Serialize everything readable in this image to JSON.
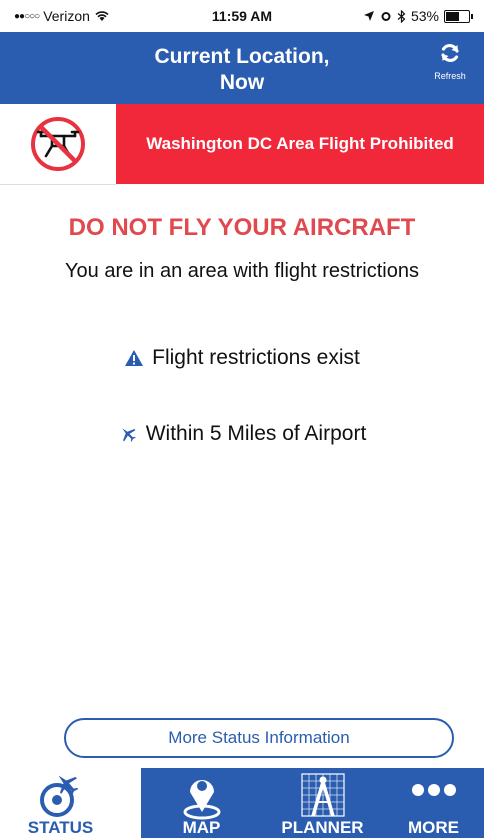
{
  "status_bar": {
    "carrier": "Verizon",
    "time": "11:59 AM",
    "battery": "53%",
    "battery_level": 0.53
  },
  "header": {
    "title_line1": "Current Location,",
    "title_line2": "Now",
    "refresh_label": "Refresh"
  },
  "banner": {
    "text": "Washington DC Area Flight Prohibited",
    "color": "#f0283a",
    "icon": "no-drone-icon"
  },
  "main": {
    "warning": "DO NOT FLY YOUR AIRCRAFT",
    "subtitle": "You are in an area with flight restrictions",
    "items": [
      {
        "icon": "warning-icon",
        "text": "Flight restrictions exist"
      },
      {
        "icon": "airplane-icon",
        "text": "Within 5 Miles of Airport"
      }
    ],
    "more_button": "More Status Information"
  },
  "tabs": [
    {
      "label": "STATUS",
      "icon": "status-icon",
      "active": true
    },
    {
      "label": "MAP",
      "icon": "map-pin-icon",
      "active": false
    },
    {
      "label": "PLANNER",
      "icon": "planner-icon",
      "active": false
    },
    {
      "label": "MORE",
      "icon": "more-icon",
      "active": false
    }
  ],
  "colors": {
    "accent": "#2a5db0",
    "warning_text": "#e04a4f"
  }
}
